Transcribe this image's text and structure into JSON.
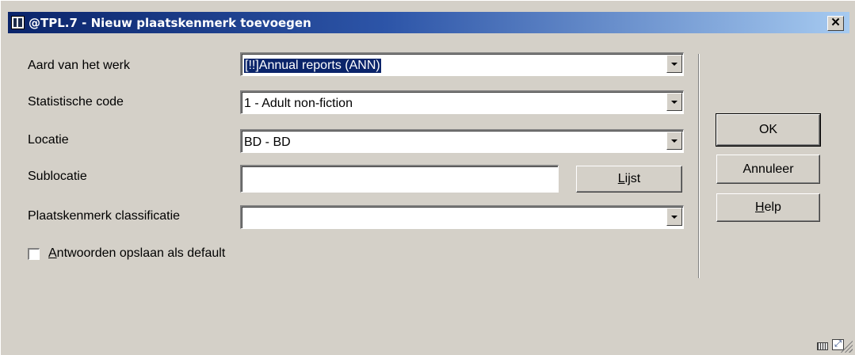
{
  "window": {
    "title": "@TPL.7 - Nieuw plaatskenmerk toevoegen",
    "close_glyph": "✕"
  },
  "form": {
    "aard": {
      "label": "Aard van het werk",
      "value": "[!!]Annual reports (ANN)"
    },
    "statistische": {
      "label": "Statistische code",
      "value": "1 - Adult non-fiction"
    },
    "locatie": {
      "label": "Locatie",
      "value": "BD - BD"
    },
    "sublocatie": {
      "label": "Sublocatie",
      "value": ""
    },
    "classificatie": {
      "label": "Plaatskenmerk classificatie",
      "value": ""
    },
    "lijst_button": "Lijst",
    "default_checkbox": {
      "label": "Antwoorden opslaan als default",
      "checked": false
    }
  },
  "buttons": {
    "ok": "OK",
    "annuleer": "Annuleer",
    "help": "Help"
  },
  "icons": {
    "app": "app-icon",
    "keyboard": "keyboard-icon",
    "resize": "resize-icon"
  },
  "colors": {
    "titlebar": "#0a246a",
    "dialog": "#d4d0c8",
    "selection": "#0a246a"
  }
}
